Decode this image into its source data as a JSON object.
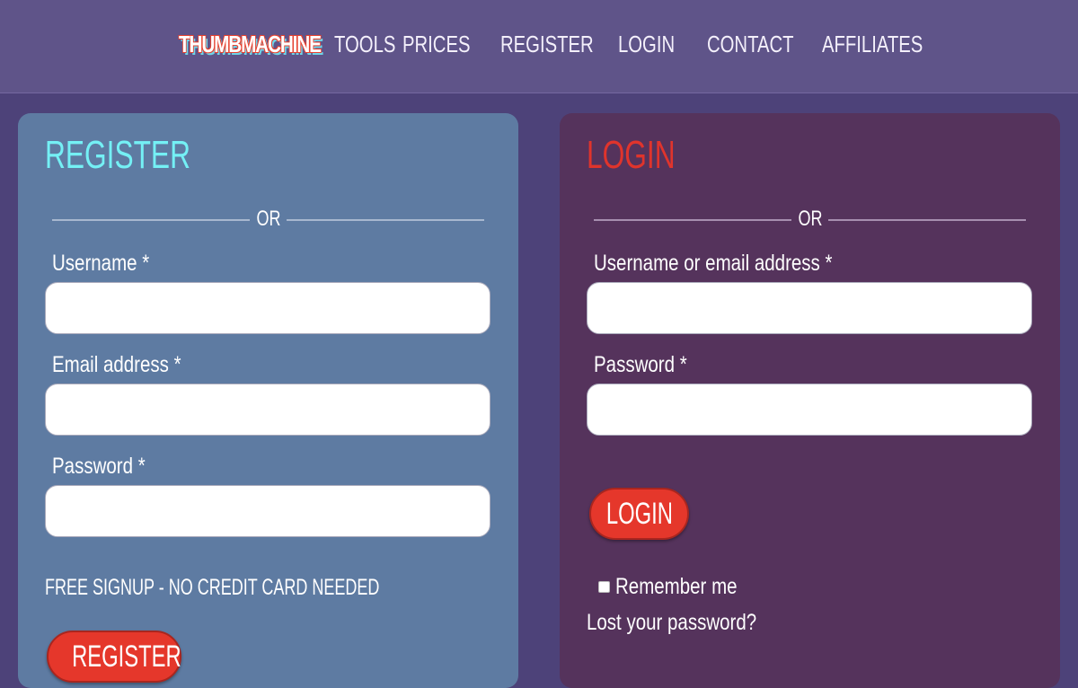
{
  "nav": {
    "logo": "THUMBMACHINE",
    "links": [
      "TOOLS",
      "PRICES",
      "REGISTER",
      "LOGIN",
      "CONTACT",
      "AFFILIATES"
    ]
  },
  "register": {
    "title": "REGISTER",
    "divider": "OR",
    "fields": [
      {
        "label": "Username *",
        "value": "",
        "placeholder": ""
      },
      {
        "label": "Email address *",
        "value": "",
        "placeholder": ""
      },
      {
        "label": "Password *",
        "value": "",
        "placeholder": ""
      }
    ],
    "note": "FREE SIGNUP - NO CREDIT CARD NEEDED",
    "button": "REGISTER"
  },
  "login": {
    "title": "LOGIN",
    "divider": "OR",
    "fields": [
      {
        "label": "Username or email address *",
        "value": "",
        "placeholder": ""
      },
      {
        "label": "Password *",
        "value": "",
        "placeholder": ""
      }
    ],
    "button": "LOGIN",
    "remember_label": "Remember me",
    "remember_checked": false,
    "lost_password": "Lost your password?"
  },
  "colors": {
    "background": "#4d4279",
    "navbar": "#5f5489",
    "register_card": "#5e7ba2",
    "login_card": "#55335c",
    "register_title": "#74f0f5",
    "login_title": "#e0342c",
    "button": "#e5372b"
  }
}
